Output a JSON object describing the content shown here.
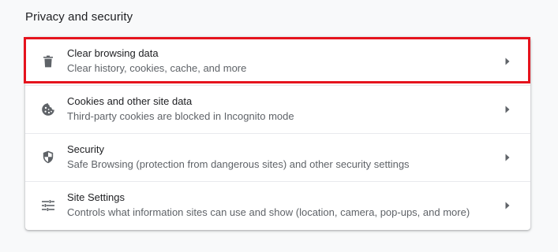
{
  "section": {
    "title": "Privacy and security"
  },
  "items": [
    {
      "label": "Clear browsing data",
      "sublabel": "Clear history, cookies, cache, and more",
      "icon": "trash-icon"
    },
    {
      "label": "Cookies and other site data",
      "sublabel": "Third-party cookies are blocked in Incognito mode",
      "icon": "cookie-icon"
    },
    {
      "label": "Security",
      "sublabel": "Safe Browsing (protection from dangerous sites) and other security settings",
      "icon": "shield-icon"
    },
    {
      "label": "Site Settings",
      "sublabel": "Controls what information sites can use and show (location, camera, pop-ups, and more)",
      "icon": "tune-icon"
    }
  ],
  "colors": {
    "highlight": "#e5131d",
    "text_primary": "#202124",
    "text_secondary": "#5f6368",
    "icon": "#5f6368"
  }
}
